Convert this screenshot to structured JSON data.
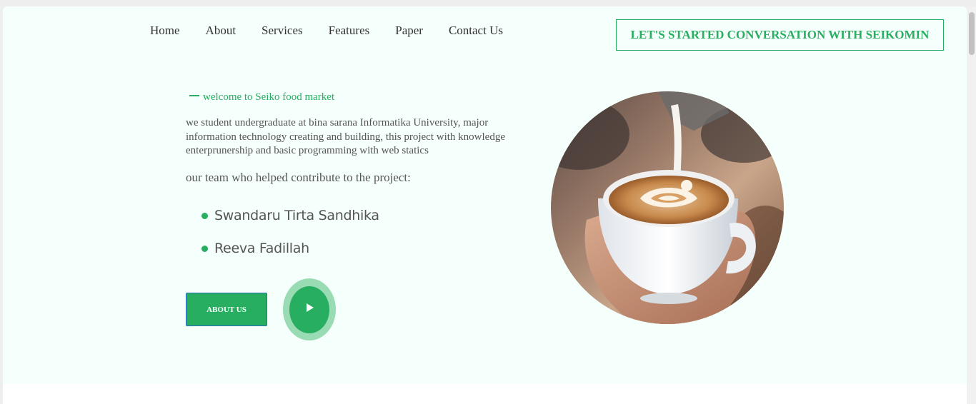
{
  "nav": {
    "items": [
      {
        "label": "Home"
      },
      {
        "label": "About"
      },
      {
        "label": "Services"
      },
      {
        "label": "Features"
      },
      {
        "label": "Paper"
      },
      {
        "label": "Contact Us"
      }
    ]
  },
  "cta": {
    "label": "LET'S STARTED CONVERSATION WITH SEIKOMIN"
  },
  "hero": {
    "welcome": "welcome to Seiko food market",
    "description": "we student undergraduate at bina sarana Informatika University, major information technology creating and building, this project with knowledge enterprunership and basic programming with web statics",
    "team_heading": "our team who helped contribute to the project:",
    "members": [
      {
        "name": "Swandaru Tirta Sandhika"
      },
      {
        "name": "Reeva Fadillah"
      }
    ],
    "about_button": "ABOUT US"
  },
  "colors": {
    "accent": "#27ae60",
    "hero_background": "#f5fffb",
    "text": "#555555"
  },
  "icons": {
    "play": "play-icon",
    "hero_image": "latte-art-coffee-cup"
  }
}
